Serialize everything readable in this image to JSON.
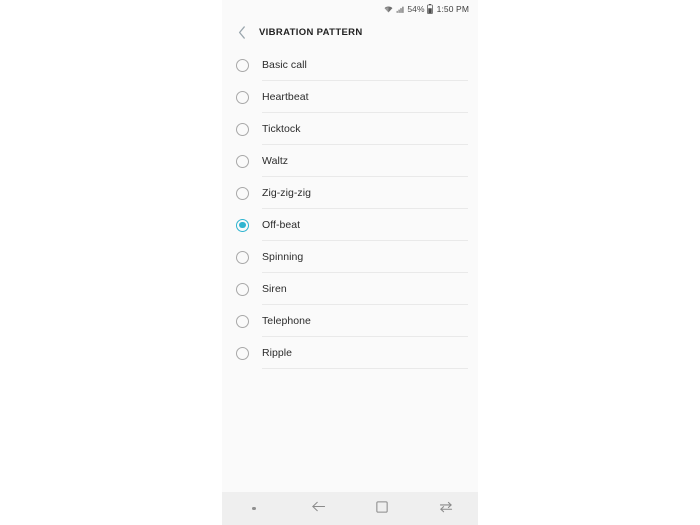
{
  "status_bar": {
    "wifi_icon": "wifi-icon",
    "signal_icon": "cellular-signal-icon",
    "battery_percent": "54%",
    "battery_icon": "battery-icon",
    "time": "1:50 PM"
  },
  "app_bar": {
    "back_icon": "back-chevron-icon",
    "title": "VIBRATION PATTERN"
  },
  "options": [
    {
      "label": "Basic call",
      "selected": false
    },
    {
      "label": "Heartbeat",
      "selected": false
    },
    {
      "label": "Ticktock",
      "selected": false
    },
    {
      "label": "Waltz",
      "selected": false
    },
    {
      "label": "Zig-zig-zig",
      "selected": false
    },
    {
      "label": "Off-beat",
      "selected": true
    },
    {
      "label": "Spinning",
      "selected": false
    },
    {
      "label": "Siren",
      "selected": false
    },
    {
      "label": "Telephone",
      "selected": false
    },
    {
      "label": "Ripple",
      "selected": false
    }
  ],
  "nav_bar": {
    "items": [
      {
        "icon": "dot-indicator-icon"
      },
      {
        "icon": "back-arrow-icon"
      },
      {
        "icon": "home-square-icon"
      },
      {
        "icon": "recents-swap-icon"
      }
    ]
  },
  "colors": {
    "accent": "#2fb4d0",
    "screen_bg": "#fafafa",
    "nav_bg": "#efefef",
    "divider": "#e9e9e9",
    "text_primary": "#2b2b2b"
  }
}
